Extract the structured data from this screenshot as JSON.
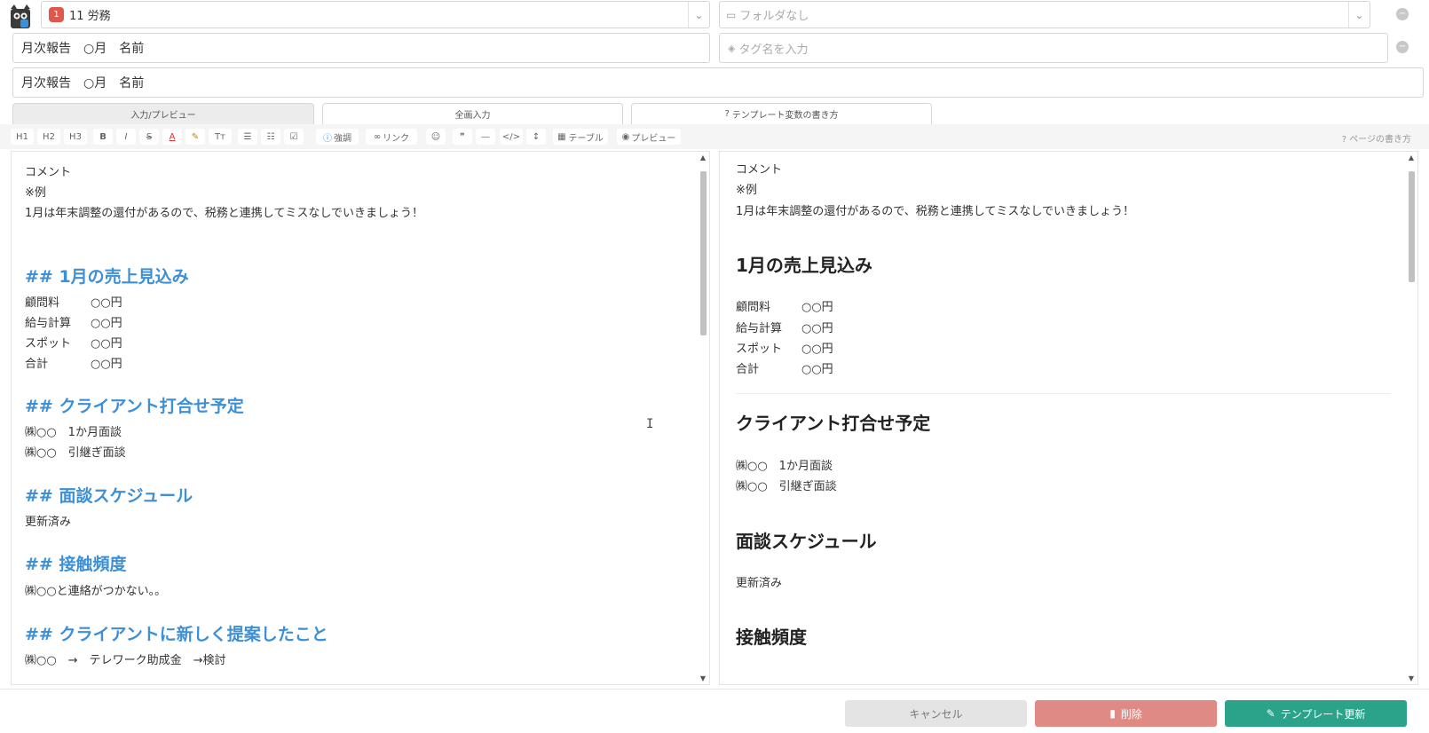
{
  "header": {
    "category": {
      "badge": "1",
      "label": "11 労務"
    },
    "folder_placeholder": "フォルダなし",
    "title_value": "月次報告　○月　名前",
    "tag_placeholder": "タグ名を入力",
    "subject_value": "月次報告　○月　名前"
  },
  "tabs": [
    {
      "label": "入力/プレビュー"
    },
    {
      "label": "全画入力"
    },
    {
      "label": "テンプレート変数の書き方"
    }
  ],
  "toolbar": {
    "h1": "H1",
    "h2": "H2",
    "h3": "H3",
    "bold": "B",
    "italic": "I",
    "strike": "S",
    "color": "A",
    "highlight": "✎",
    "size": "Tт",
    "ul": "☰",
    "ol": "☷",
    "check": "☑",
    "emphasis": "強調",
    "link": "リンク",
    "emoji": "☺",
    "quote": "❞",
    "hr": "—",
    "code": "</>",
    "expand": "↕",
    "table": "テーブル",
    "preview": "プレビュー",
    "help": "ページの書き方"
  },
  "editor": {
    "comment": "コメント",
    "example": "※例",
    "intro": "1月は年末調整の還付があるので、税務と連携してミスなしでいきましょう！",
    "h_sales": "## 1月の売上見込み",
    "sales": [
      {
        "k": "顧問料",
        "v": "○○円"
      },
      {
        "k": "給与計算",
        "v": "○○円"
      },
      {
        "k": "スポット",
        "v": "○○円"
      },
      {
        "k": "合計",
        "v": "○○円"
      }
    ],
    "h_meet": "## クライアント打合せ予定",
    "meet": [
      "㈱○○　1か月面談",
      "㈱○○　引継ぎ面談"
    ],
    "h_interview": "## 面談スケジュール",
    "interview": "更新済み",
    "h_contact": "## 接触頻度",
    "contact": "㈱○○と連絡がつかない。。",
    "h_proposal": "## クライアントに新しく提案したこと",
    "proposal": "㈱○○　→　テレワーク助成金　→検討"
  },
  "preview": {
    "comment": "コメント",
    "example": "※例",
    "intro": "1月は年末調整の還付があるので、税務と連携してミスなしでいきましょう！",
    "h_sales": "1月の売上見込み",
    "sales": [
      {
        "k": "顧問料",
        "v": "○○円"
      },
      {
        "k": "給与計算",
        "v": "○○円"
      },
      {
        "k": "スポット",
        "v": "○○円"
      },
      {
        "k": "合計",
        "v": "○○円"
      }
    ],
    "h_meet": "クライアント打合せ予定",
    "meet": [
      "㈱○○　1か月面談",
      "㈱○○　引継ぎ面談"
    ],
    "h_interview": "面談スケジュール",
    "interview": "更新済み",
    "h_contact": "接触頻度"
  },
  "footer": {
    "cancel": "キャンセル",
    "delete": "削除",
    "update": "テンプレート更新"
  },
  "colors": {
    "heading_blue": "#3d8fd6",
    "delete": "#df8a84",
    "update": "#2aa38a",
    "badge": "#e2574c"
  }
}
